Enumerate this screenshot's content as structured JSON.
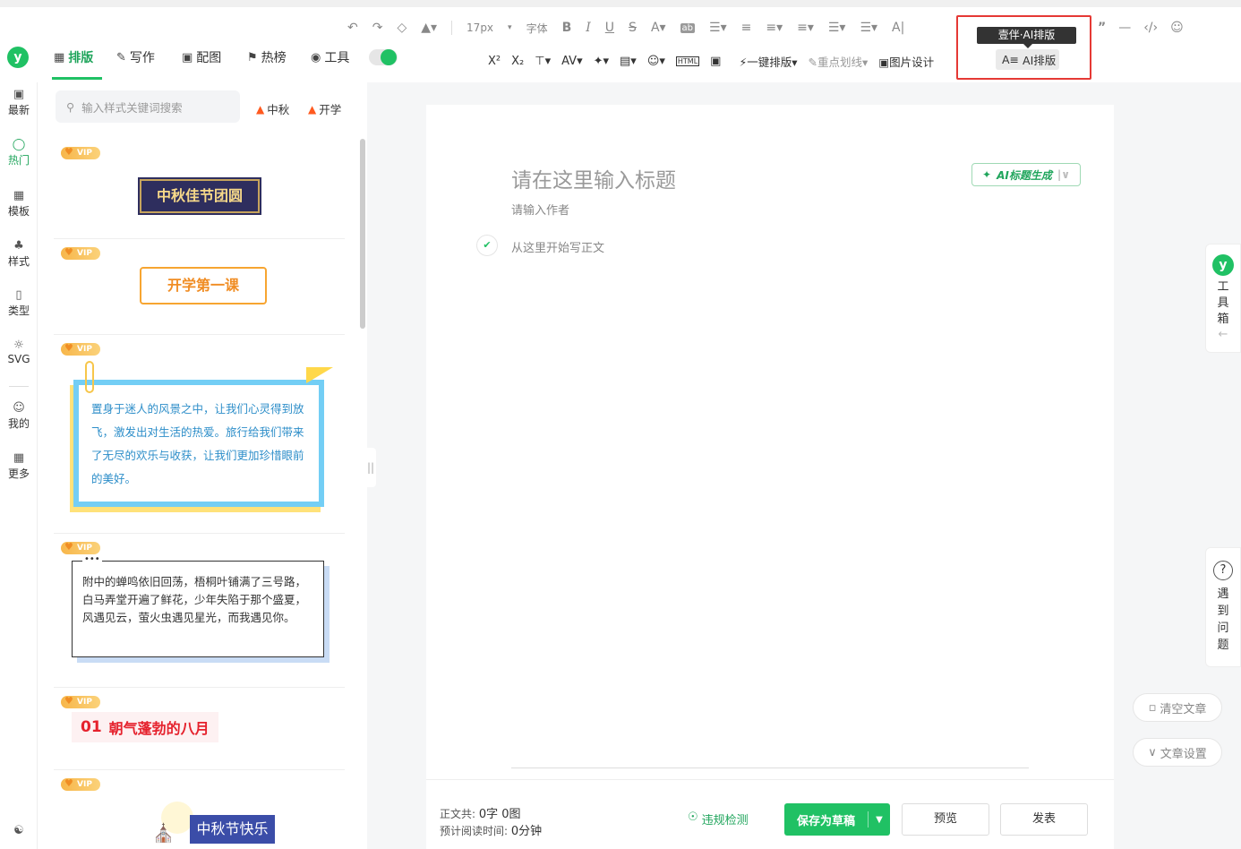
{
  "header": {
    "logo": "y",
    "tabs": [
      {
        "label": "排版",
        "icon": "layout-icon"
      },
      {
        "label": "写作",
        "icon": "pen-icon"
      },
      {
        "label": "配图",
        "icon": "image-icon"
      },
      {
        "label": "热榜",
        "icon": "bookmark-icon"
      },
      {
        "label": "工具",
        "icon": "box-icon"
      }
    ],
    "font_size": "17px",
    "font_family": "字体",
    "one_click_layout": "一键排版",
    "highlight_underline": "重点划线",
    "image_design": "图片设计",
    "ai_layout": "AI排版",
    "tooltip": "壹伴·AI排版"
  },
  "leftnav": [
    {
      "label": "最新",
      "icon": "chat-icon"
    },
    {
      "label": "热门",
      "icon": "fire-icon"
    },
    {
      "label": "模板",
      "icon": "template-icon"
    },
    {
      "label": "样式",
      "icon": "style-icon"
    },
    {
      "label": "类型",
      "icon": "type-icon"
    },
    {
      "label": "SVG",
      "icon": "svg-icon"
    },
    {
      "label": "我的",
      "icon": "user-icon"
    },
    {
      "label": "更多",
      "icon": "grid-icon"
    }
  ],
  "panel": {
    "search_placeholder": "输入样式关键词搜索",
    "hot_tags": [
      "中秋",
      "开学"
    ],
    "vip": "VIP",
    "cards": {
      "mid_autumn": "中秋佳节团圆",
      "first_lesson": "开学第一课",
      "travel_text": "置身于迷人的风景之中，让我们心灵得到放飞，激发出对生活的热爱。旅行给我们带来了无尽的欢乐与收获，让我们更加珍惜眼前的美好。",
      "summer_text": "附中的蝉鸣依旧回荡，梧桐叶铺满了三号路，白马弄堂开遍了鲜花，少年失陷于那个盛夏，风遇见云，萤火虫遇见星光，而我遇见你。",
      "august_num": "01",
      "august_text": "朝气蓬勃的八月",
      "festival_text": "中秋节快乐"
    }
  },
  "editor": {
    "title_placeholder": "请在这里输入标题",
    "author_placeholder": "请输入作者",
    "body_placeholder": "从这里开始写正文",
    "ai_title_btn": "AI标题生成"
  },
  "footer": {
    "word_count_label": "正文共:",
    "word_count_value": "0字 0图",
    "read_time_label": "预计阅读时间:",
    "read_time_value": "0分钟",
    "check": "违规检测",
    "save": "保存为草稿",
    "preview": "预览",
    "publish": "发表"
  },
  "right": {
    "toolbox": "工具箱",
    "help": "遇到问题",
    "clear": "清空文章",
    "settings": "文章设置"
  }
}
